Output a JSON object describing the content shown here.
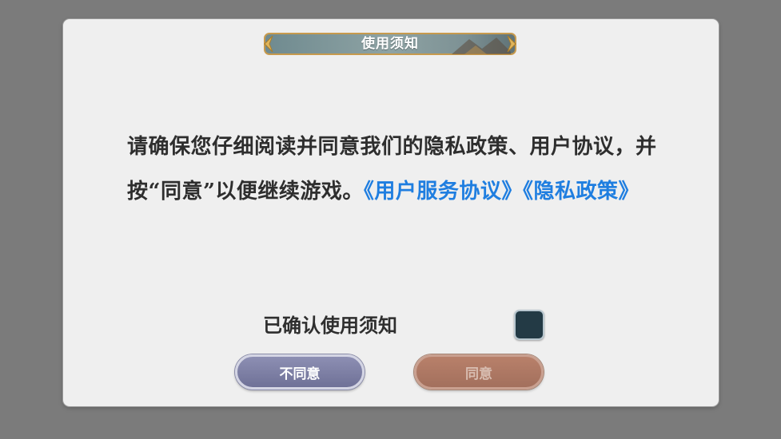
{
  "dialog": {
    "title": "使用须知",
    "body_text": "请确保您仔细阅读并同意我们的隐私政策、用户协议，并按“同意”以便继续游戏。",
    "links": {
      "user_agreement": "《用户服务协议》",
      "privacy_policy": "《隐私政策》"
    },
    "confirm_label": "已确认使用须知",
    "checkbox_checked": false,
    "buttons": {
      "disagree_label": "不同意",
      "agree_label": "同意",
      "agree_enabled": false
    }
  },
  "colors": {
    "overlay": "#7b7b7b",
    "dialog_bg": "#efefef",
    "link": "#1f7ee0",
    "disagree_button": "#7f81a6",
    "agree_button": "#a9735f",
    "checkbox": "#233a45"
  },
  "icons": [
    "banner-left-arrow-icon",
    "banner-right-arrow-icon"
  ]
}
